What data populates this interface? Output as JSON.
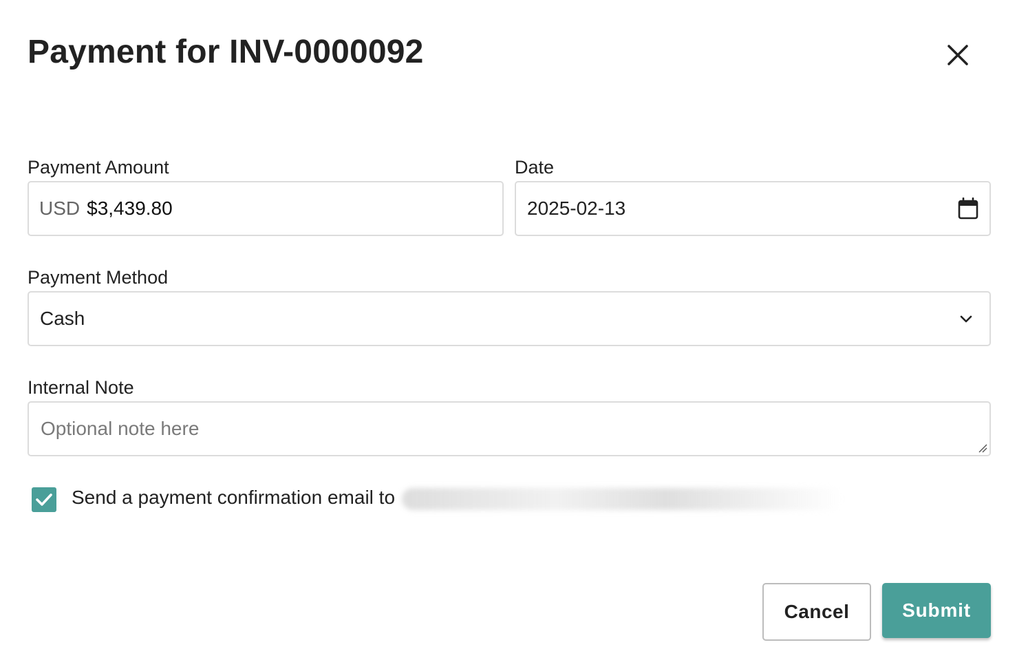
{
  "dialog": {
    "title": "Payment for INV-0000092",
    "close_icon": "close-icon"
  },
  "payment_amount": {
    "label": "Payment Amount",
    "currency": "USD",
    "value": "$3,439.80"
  },
  "date": {
    "label": "Date",
    "value": "2025-02-13",
    "icon": "calendar-icon"
  },
  "payment_method": {
    "label": "Payment Method",
    "selected": "Cash",
    "icon": "chevron-down-icon"
  },
  "internal_note": {
    "label": "Internal Note",
    "placeholder": "Optional note here",
    "value": ""
  },
  "confirmation": {
    "checked": true,
    "label": "Send a payment confirmation email to"
  },
  "actions": {
    "cancel_label": "Cancel",
    "submit_label": "Submit"
  },
  "colors": {
    "accent": "#4a9f99",
    "border": "#dcdcdc",
    "text": "#222222",
    "placeholder": "#7a7a7a"
  }
}
